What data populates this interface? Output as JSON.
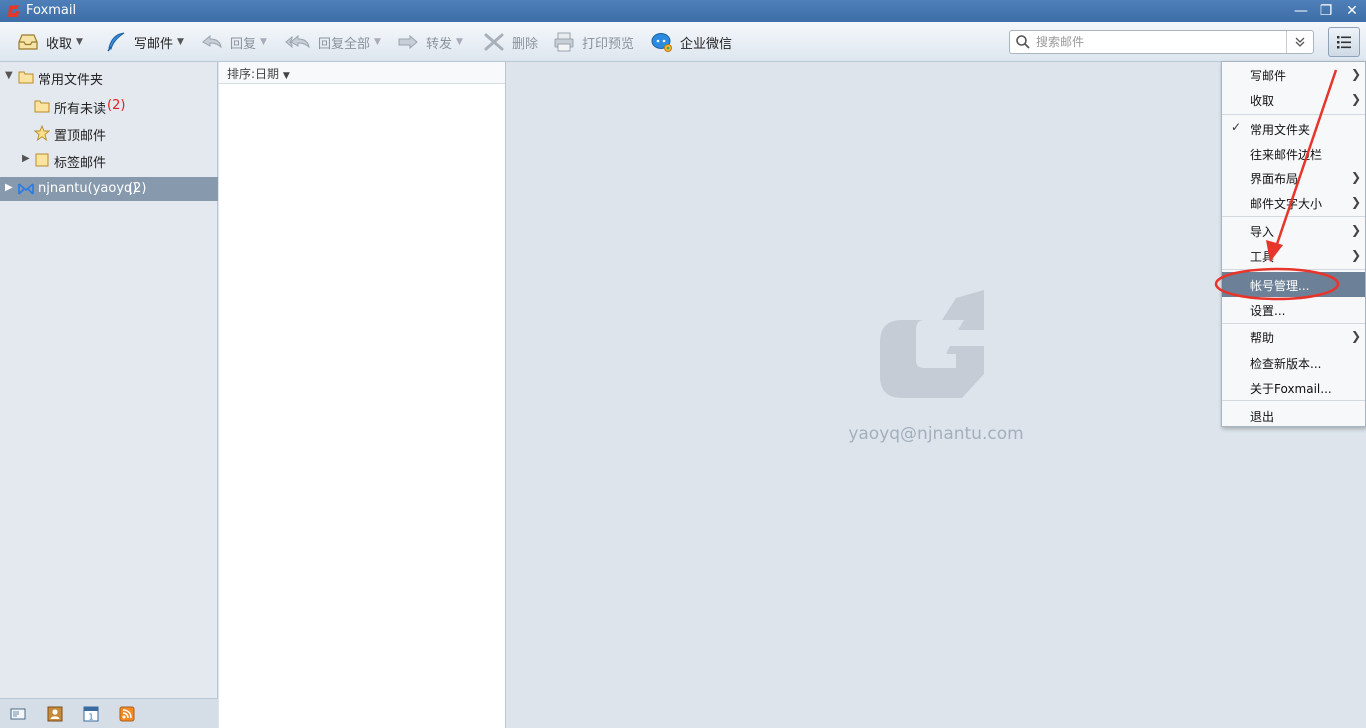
{
  "window": {
    "title": "Foxmail",
    "minimize": "—",
    "restore": "❐",
    "close": "✕"
  },
  "toolbar": {
    "receive": "收取",
    "compose": "写邮件",
    "reply": "回复",
    "reply_all": "回复全部",
    "forward": "转发",
    "delete": "删除",
    "print_preview": "打印预览",
    "wecom": "企业微信"
  },
  "search": {
    "placeholder": "搜索邮件",
    "value": ""
  },
  "folders": {
    "common": "常用文件夹",
    "all_unread": "所有未读",
    "all_unread_count": "(2)",
    "pinned": "置顶邮件",
    "tagged": "标签邮件",
    "account": "njnantu(yaoyq)",
    "account_count": "(2)"
  },
  "mail_list": {
    "sort_label": "排序:日期"
  },
  "preview": {
    "account_email": "yaoyq@njnantu.com"
  },
  "menu": {
    "items": [
      {
        "label": "写邮件"
      },
      {
        "label": "收取"
      },
      {
        "label": "常用文件夹"
      },
      {
        "label": "往来邮件边栏"
      },
      {
        "label": "界面布局"
      },
      {
        "label": "邮件文字大小"
      },
      {
        "label": "导入"
      },
      {
        "label": "工具"
      },
      {
        "label": "帐号管理..."
      },
      {
        "label": "设置..."
      },
      {
        "label": "帮助"
      },
      {
        "label": "检查新版本..."
      },
      {
        "label": "关于Foxmail..."
      },
      {
        "label": "退出"
      }
    ]
  },
  "colors": {
    "titlebar": "#3d6ea8",
    "highlight": "#6c8197",
    "annotation": "#e8352b",
    "unread_count": "#e02020"
  }
}
